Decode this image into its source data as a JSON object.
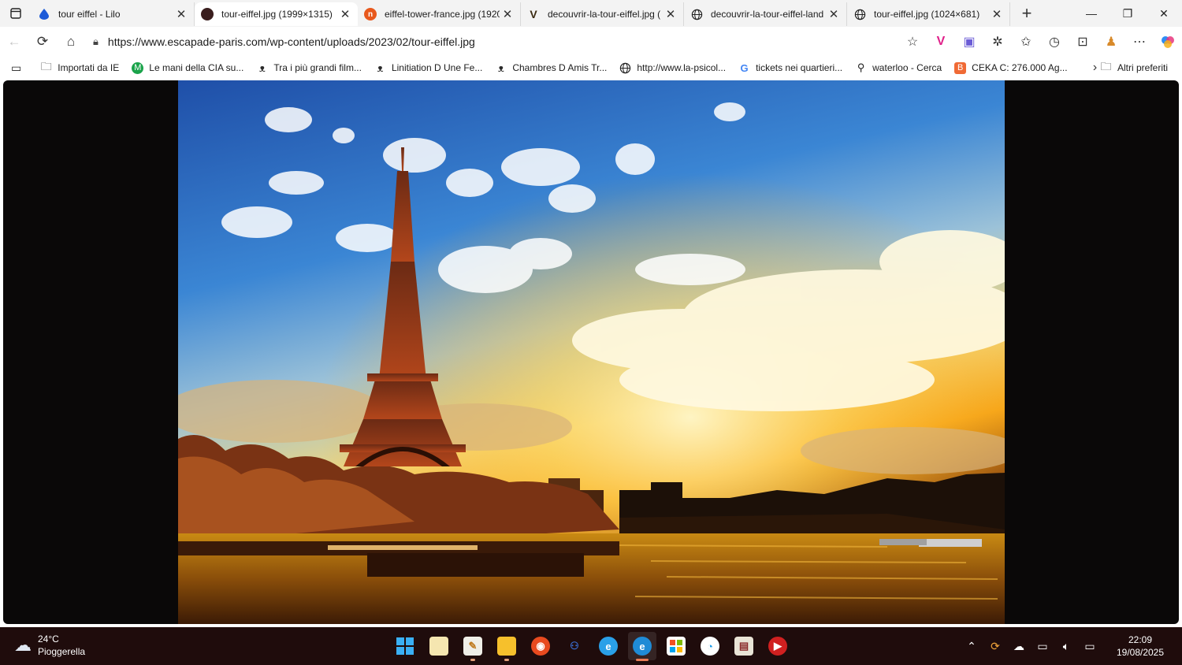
{
  "tabs": [
    {
      "title": "tour eiffel - Lilo",
      "icon": "lilo-drop-icon",
      "color": "#1d5bd8"
    },
    {
      "title": "tour-eiffel.jpg (1999×1315)",
      "icon": "globe-dark-icon",
      "color": "#3a1e1e"
    },
    {
      "title": "eiffel-tower-france.jpg (1920",
      "icon": "orange-n-icon",
      "color": "#e8581c"
    },
    {
      "title": "decouvrir-la-tour-eiffel.jpg (",
      "icon": "v-logo-icon",
      "color": "#3a2a10"
    },
    {
      "title": "decouvrir-la-tour-eiffel-land",
      "icon": "globe-icon",
      "color": "#555555"
    },
    {
      "title": "tour-eiffel.jpg (1024×681)",
      "icon": "globe-icon",
      "color": "#555555"
    }
  ],
  "address": {
    "url": "https://www.escapade-paris.com/wp-content/uploads/2023/02/tour-eiffel.jpg"
  },
  "bookmarks": {
    "items": [
      {
        "label": "Importati da IE",
        "icon": "folder-icon"
      },
      {
        "label": "Le mani della CIA su...",
        "icon": "green-m-icon"
      },
      {
        "label": "Tra i più grandi film...",
        "icon": "owl-icon"
      },
      {
        "label": "Linitiation D Une Fe...",
        "icon": "owl-icon"
      },
      {
        "label": "Chambres D Amis Tr...",
        "icon": "owl-icon"
      },
      {
        "label": "http://www.la-psicol...",
        "icon": "globe-icon"
      },
      {
        "label": "tickets nei quartieri...",
        "icon": "google-icon"
      },
      {
        "label": "waterloo - Cerca",
        "icon": "search-icon"
      },
      {
        "label": "CEKA C: 276.000 Ag...",
        "icon": "blogger-icon"
      }
    ],
    "others_label": "Altri preferiti"
  },
  "taskbar": {
    "weather_temp": "24°C",
    "weather_desc": "Pioggerella",
    "time": "22:09",
    "date": "19/08/2025"
  },
  "colors": {
    "taskbar_bg": "#1f0c0c",
    "accent": "#e87c56"
  }
}
